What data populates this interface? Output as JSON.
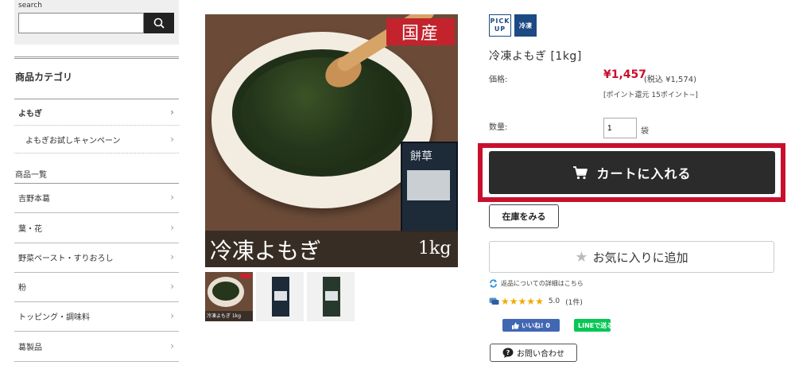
{
  "search": {
    "label": "search",
    "value": "",
    "placeholder": ""
  },
  "sidebar": {
    "category_title": "商品カテゴリ",
    "category_items": [
      {
        "label": "よもぎ"
      },
      {
        "label": "よもぎお試しキャンペーン"
      }
    ],
    "list_title": "商品一覧",
    "list_items": [
      {
        "label": "吉野本葛"
      },
      {
        "label": "葉・花"
      },
      {
        "label": "野菜ペースト・すりおろし"
      },
      {
        "label": "粉"
      },
      {
        "label": "トッピング・調味料"
      },
      {
        "label": "葛製品"
      }
    ]
  },
  "image": {
    "badge": "国産",
    "band_name": "冷凍よもぎ",
    "band_size": "1kg",
    "package_text": "餅草",
    "thumb1_caption": "冷凍よもぎ 1kg"
  },
  "product": {
    "badge_pickup_l1": "PICK",
    "badge_pickup_l2": "UP",
    "badge_frozen": "冷凍",
    "name": "冷凍よもぎ [1kg]",
    "price_label": "価格:",
    "price": "¥1,457",
    "price_tax": "(税込 ¥1,574)",
    "points": "[ポイント還元 15ポイント~]",
    "qty_label": "数量:",
    "qty_value": "1",
    "qty_unit": "袋",
    "cart_button": "カートに入れる",
    "stock_button": "在庫をみる",
    "favorite_button": "お気に入りに追加",
    "return_link": "返品についての詳細はこちら",
    "rating": "5.0",
    "review_count": "(1件)",
    "star_count": 5,
    "fb_button": "いいね! 0",
    "line_button": "LINEで送る",
    "contact_button": "お問い合わせ"
  },
  "colors": {
    "accent_red": "#c8102e",
    "cart_dark": "#2b2b2b",
    "badge_blue": "#1d4a83",
    "star": "#f2a900"
  },
  "icons": [
    "search-icon",
    "chevron-right-icon",
    "cart-icon",
    "star-icon",
    "refresh-icon",
    "comment-icon",
    "thumbs-up-icon",
    "line-icon",
    "question-bubble-icon"
  ]
}
